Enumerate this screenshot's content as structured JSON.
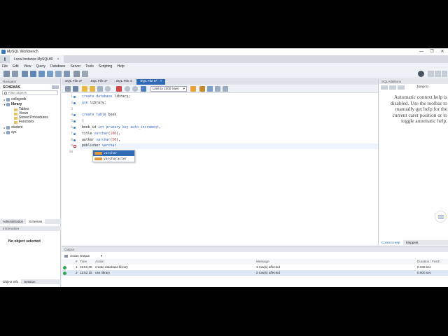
{
  "window": {
    "title": "MySQL Workbench",
    "controls": [
      "—",
      "❐",
      "✕"
    ]
  },
  "app_tabs": [
    {
      "label": "Local instance MySQL80"
    }
  ],
  "menu": [
    "File",
    "Edit",
    "View",
    "Query",
    "Database",
    "Server",
    "Tools",
    "Scripting",
    "Help"
  ],
  "navigator": {
    "header": "Navigator",
    "schemas_label": "SCHEMAS",
    "filter_placeholder": "Filter objects",
    "tree": [
      {
        "label": "collegedb",
        "level": 0,
        "expanded": false
      },
      {
        "label": "library",
        "level": 0,
        "expanded": true,
        "bold": true
      },
      {
        "label": "Tables",
        "level": 1
      },
      {
        "label": "Views",
        "level": 1
      },
      {
        "label": "Stored Procedures",
        "level": 1
      },
      {
        "label": "Functions",
        "level": 1
      },
      {
        "label": "student",
        "level": 0,
        "expanded": false
      },
      {
        "label": "sys",
        "level": 0,
        "expanded": false
      }
    ],
    "tabs": [
      "Administration",
      "Schemas"
    ],
    "info_header": "Information",
    "no_object": "No object selected",
    "bottom_tabs": [
      "Object Info",
      "Session"
    ]
  },
  "editor": {
    "tabs": [
      "SQL File 3*",
      "SQL File 3*",
      "SQL File 4",
      "SQL File 5*"
    ],
    "active_tab": 3,
    "close_glyph": "×",
    "limit_label": "Limit to 1000 rows",
    "lines": [
      {
        "n": "1",
        "text": "create database library;"
      },
      {
        "n": "2",
        "text": "use library;"
      },
      {
        "n": "3",
        "text": ""
      },
      {
        "n": "4",
        "text": "create table book"
      },
      {
        "n": "5",
        "text": "("
      },
      {
        "n": "6",
        "text": "book_id int primary key auto_increment,"
      },
      {
        "n": "7",
        "text": "title varchar(100),"
      },
      {
        "n": "8",
        "text": "author varchar(50),"
      },
      {
        "n": "9",
        "text": "publisher varchar"
      },
      {
        "n": "10",
        "text": ""
      }
    ],
    "autocomplete": [
      "varchar",
      "varcharacter"
    ]
  },
  "sql_additions": {
    "header": "SQLAdditions",
    "jump_to": "Jump to",
    "help_text": "Automatic context help is disabled. Use the toolbar to manually get help for the current caret position or to toggle automatic help.",
    "tabs": [
      "Context Help",
      "Snippets"
    ]
  },
  "output": {
    "header": "Output",
    "selector": "Action Output",
    "columns": [
      "#",
      "Time",
      "Action",
      "Message",
      "Duration / Fetch"
    ],
    "rows": [
      {
        "num": "1",
        "time": "11:51:35",
        "action": "create database library",
        "message": "1 row(s) affected",
        "duration": "0.046 sec"
      },
      {
        "num": "2",
        "time": "11:52:15",
        "action": "use library",
        "message": "0 row(s) affected",
        "duration": "0.000 sec"
      }
    ]
  },
  "colors": {
    "accent": "#2f6bb4",
    "keyword": "#3565c7",
    "number": "#b33a3a",
    "success": "#2ea44f"
  }
}
